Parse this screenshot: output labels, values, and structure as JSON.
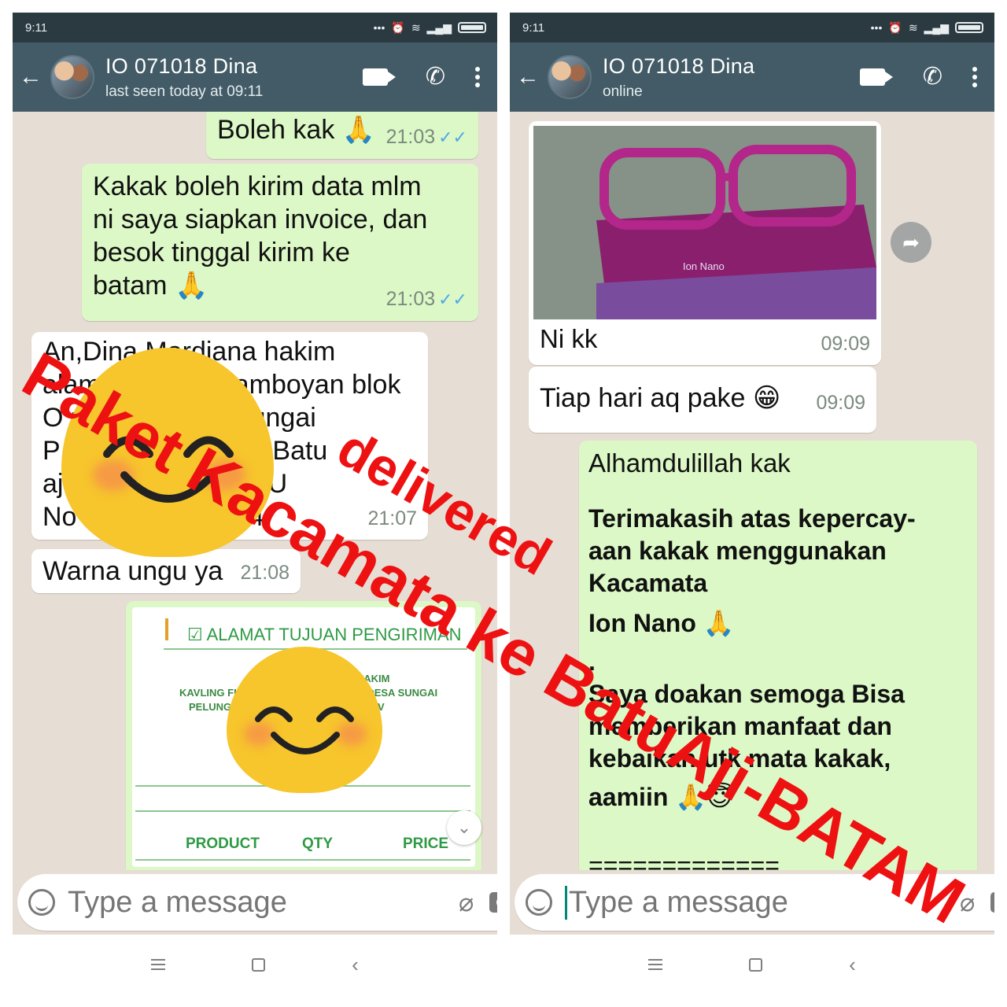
{
  "status_bar": {
    "time": "9:11",
    "icons": [
      "more-dots",
      "alarm",
      "wifi",
      "signal",
      "battery"
    ]
  },
  "composer": {
    "placeholder": "Type a message"
  },
  "left": {
    "chat_title": "IO 071018 Dina",
    "chat_status": "last seen today at 09:11",
    "messages": {
      "m1": {
        "text": "Boleh kak",
        "emoji": "🙏",
        "time": "21:03",
        "ticks": "✓✓"
      },
      "m2": {
        "l1": "Kakak boleh kirim data mlm",
        "l2": "ni saya siapkan invoice, dan",
        "l3": "besok tinggal kirim ke",
        "l4": "batam",
        "emoji": "🙏",
        "time": "21:03",
        "ticks": "✓✓"
      },
      "m3": {
        "l1": "An,Dina Mardiana hakim",
        "l2": "alamat kavling flamboyan blok",
        "l3": "O no 4 kel/desa sungai",
        "l4": "P elunggut tanjung Batu",
        "l5": "aji batam prov. RIAU",
        "l6": "No hp 0813 xxxx 4",
        "time": "21:07"
      },
      "m4": {
        "text": "Warna ungu ya",
        "time": "21:08"
      },
      "m5": {
        "header": "ALAMAT TUJUAN PENGIRIMAN",
        "r1": "IBU DINA MARDIANA HAKIM",
        "r2": "KAVLING FLAMBOYAN BLOK O - KEL/DESA SUNGAI",
        "r3": "PELUNGGUT - BATU AJI - BATAM PROV",
        "col_product": "PRODUCT",
        "col_qty": "QTY",
        "col_price": "PRICE"
      }
    }
  },
  "right": {
    "chat_title": "IO 071018 Dina",
    "chat_status": "online",
    "messages": {
      "r1": {
        "image_text": "Ion Nano",
        "caption": "Ni kk",
        "time": "09:09"
      },
      "r2": {
        "text": "Tiap hari aq pake",
        "emoji": "😁",
        "time": "09:09"
      },
      "r3": {
        "l1": "Alhamdulillah kak",
        "l2": "Terimakasih atas kepercay-",
        "l3": "aan kakak menggunakan Kacamata",
        "l4": "Ion Nano",
        "emoji1": "🙏",
        "l5": ".",
        "l6": "Saya doakan semoga Bisa",
        "l7": "memberikan manfaat dan",
        "l8": "kebaikan utk mata kakak,",
        "l9": "aamiin",
        "emoji2": "🙏😇",
        "l10": "============="
      }
    }
  },
  "watermark": {
    "line1": "Paket Kacamata ke BatuAji-BATAM",
    "line2": "delivered",
    "color": "#ee1111"
  },
  "colors": {
    "appbar": "#435b66",
    "statusbar": "#2b3a41",
    "outgoing": "#dcf8c6",
    "incoming": "#ffffff",
    "mic": "#00897b"
  }
}
